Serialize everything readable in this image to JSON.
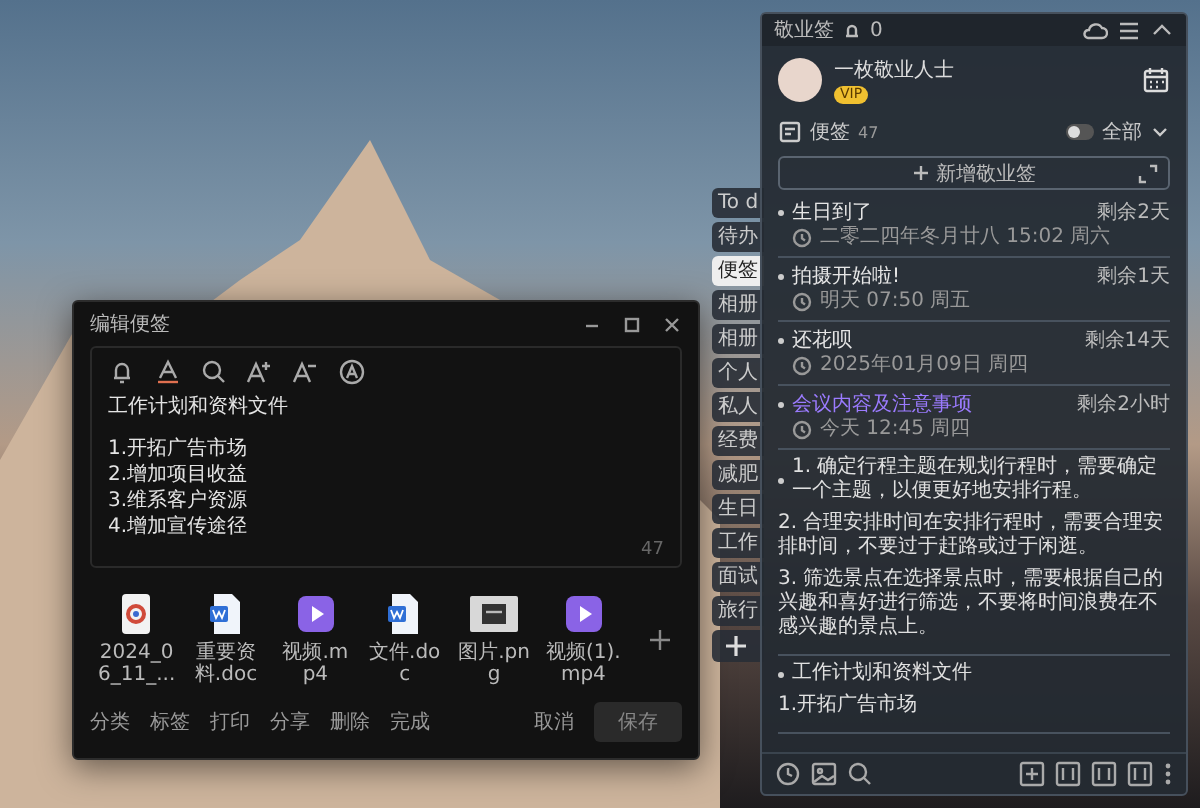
{
  "editor": {
    "title": "编辑便签",
    "heading": "工作计划和资料文件",
    "items": [
      "1.开拓广告市场",
      "2.增加项目收益",
      "3.维系客户资源",
      "4.增加宣传途径"
    ],
    "char_count": "47",
    "attachments": [
      {
        "name": "2024_06_11_...",
        "kind": "photo"
      },
      {
        "name": "重要资料.doc",
        "kind": "word"
      },
      {
        "name": "视频.mp4",
        "kind": "video"
      },
      {
        "name": "文件.doc",
        "kind": "word"
      },
      {
        "name": "图片.png",
        "kind": "image"
      },
      {
        "name": "视频(1).mp4",
        "kind": "video"
      }
    ],
    "actions": [
      "分类",
      "标签",
      "打印",
      "分享",
      "删除",
      "完成"
    ],
    "cancel": "取消",
    "save": "保存"
  },
  "tabs": [
    {
      "label": "To d",
      "selected": false
    },
    {
      "label": "待办",
      "selected": false
    },
    {
      "label": "便签",
      "selected": true
    },
    {
      "label": "相册",
      "selected": false
    },
    {
      "label": "相册",
      "selected": false
    },
    {
      "label": "个人",
      "selected": false
    },
    {
      "label": "私人",
      "selected": false
    },
    {
      "label": "经费",
      "selected": false
    },
    {
      "label": "减肥",
      "selected": false
    },
    {
      "label": "生日",
      "selected": false
    },
    {
      "label": "工作",
      "selected": false
    },
    {
      "label": "面试",
      "selected": false
    },
    {
      "label": "旅行",
      "selected": false
    }
  ],
  "panel": {
    "app_name": "敬业签",
    "notification_count": "0",
    "user": {
      "name": "一枚敬业人士",
      "badge": "VIP"
    },
    "section": {
      "label": "便签",
      "count": "47",
      "toggle_on": false,
      "filter": "全部"
    },
    "new_button": "新增敬业签",
    "notes": [
      {
        "kind": "reminder",
        "countdown": "剩余2天",
        "title": "生日到了",
        "time": "二零二四年冬月廿八 15:02 周六",
        "color": "#e6e6e6"
      },
      {
        "kind": "reminder",
        "countdown": "剩余1天",
        "title": "拍摄开始啦!",
        "time": "明天 07:50 周五",
        "color": "#e6e6e6"
      },
      {
        "kind": "reminder",
        "countdown": "剩余14天",
        "title": "还花呗",
        "time": "2025年01月09日 周四",
        "color": "#e6e6e6"
      },
      {
        "kind": "reminder",
        "countdown": "剩余2小时",
        "title": "会议内容及注意事项",
        "time": "今天 12:45 周四",
        "color": "#9b7bff"
      },
      {
        "kind": "text",
        "paragraphs": [
          "1. 确定行程主题在规划行程时，需要确定一个主题，以便更好地安排行程。",
          "2. 合理安排时间在安排行程时，需要合理安排时间，不要过于赶路或过于闲逛。",
          "3. 筛选景点在选择景点时，需要根据自己的兴趣和喜好进行筛选，不要将时间浪费在不感兴趣的景点上。"
        ]
      },
      {
        "kind": "text",
        "paragraphs": [
          "工作计划和资料文件",
          "1.开拓广告市场"
        ]
      }
    ]
  }
}
